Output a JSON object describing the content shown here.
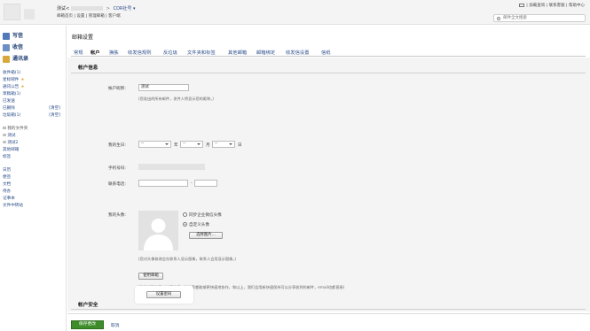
{
  "header": {
    "account_name": "测试<",
    "separator": ">",
    "org_label": "CDR社号",
    "links": "邮箱首页 | 设置 | 管理邮箱 | 客户端",
    "top_links": "| 加载查询 | 联系客服 | 帮助中心",
    "search_placeholder": "邮件全文搜索"
  },
  "sidebar": {
    "write": "写信",
    "inbox": "收信",
    "contacts": "通讯录",
    "items": [
      {
        "label": "收件箱(1)"
      },
      {
        "label": "星标邮件"
      },
      {
        "label": "通讯公告"
      },
      {
        "label": "草稿箱(1)"
      },
      {
        "label": "已发送"
      },
      {
        "label": "已删除",
        "count": "[清空]"
      },
      {
        "label": "垃圾箱(1)",
        "count": "[清空]"
      }
    ],
    "folders": [
      {
        "label": "我的文件夹"
      },
      {
        "label": "测试"
      },
      {
        "label": "测试2"
      },
      {
        "label": "其他邮箱"
      },
      {
        "label": "标签"
      }
    ],
    "apps": [
      {
        "label": "日历"
      },
      {
        "label": "便签"
      },
      {
        "label": "文档"
      },
      {
        "label": "待办"
      },
      {
        "label": "记事本"
      },
      {
        "label": "文件中转站"
      }
    ]
  },
  "main": {
    "title": "邮箱设置",
    "tabs": [
      "常规",
      "帐户",
      "换肤",
      "收发信规则",
      "反垃圾",
      "文件夹和标签",
      "其他邮箱",
      "邮箱绑定",
      "收发信设置",
      "信纸"
    ],
    "active_tab": 1,
    "account_info_title": "帐户信息",
    "nickname_label": "帐户昵称:",
    "nickname_value": "测试",
    "nickname_note": "(您发出的所有邮件，发件人将显示您的昵称。)",
    "birthday_label": "我的生日:",
    "year_select": "--",
    "month_select": "--",
    "day_select": "--",
    "year_unit": "年",
    "month_unit": "月",
    "day_unit": "日",
    "phone_label": "手机号码:",
    "landline_label": "联系电话:",
    "landline_sep": "-",
    "avatar_label": "我的头像:",
    "avatar_option_sync": "同步企业微信头像",
    "avatar_option_custom": "自定义头像",
    "avatar_selected": "custom",
    "choose_image_button": "选择图片...",
    "avatar_note": "(您对头像修改会在联系人显示图像，联系人会用显示图像。)",
    "use_mail_button": "使用邮箱",
    "use_mail_note": "(\"邮箱\"插件可以快速使用，让大家都能够更快速地协作，和以上，我们会用新快速保持可以分享收到的邮件，email也都直接)",
    "security_title": "帐户安全",
    "set_password_button": "设置密码"
  },
  "footer": {
    "save": "保存更改",
    "cancel": "取消"
  },
  "colors": {
    "link": "#2a4d8a",
    "save_green": "#3e8d2a",
    "content_bg": "#f4f4f4"
  }
}
